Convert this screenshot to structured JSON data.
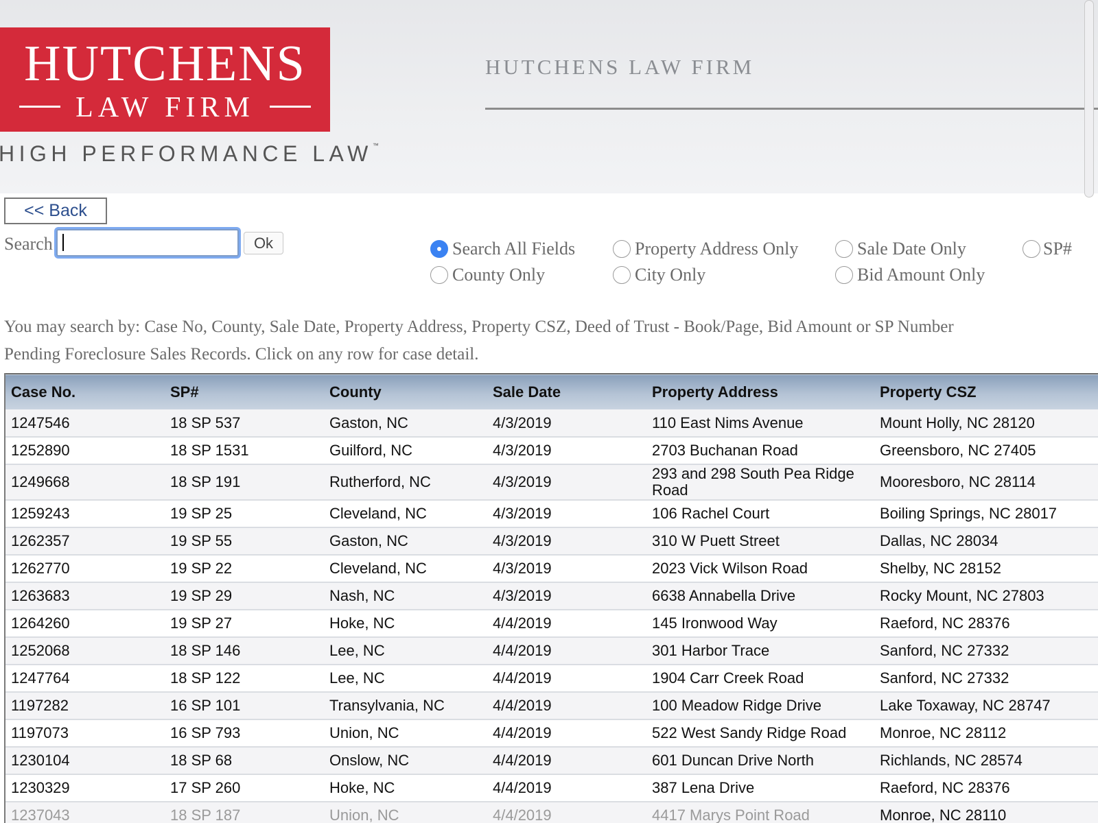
{
  "header": {
    "logo_name": "HUTCHENS",
    "logo_sub": "LAW FIRM",
    "tagline": "HIGH PERFORMANCE LAW",
    "tagline_tm": "™",
    "firm_title": "HUTCHENS LAW FIRM"
  },
  "controls": {
    "back_label": "<< Back",
    "search_label": "Search",
    "search_value": "",
    "ok_label": "Ok"
  },
  "radio_options": [
    {
      "label": "Search All Fields",
      "checked": true
    },
    {
      "label": "Property Address Only",
      "checked": false
    },
    {
      "label": "Sale Date Only",
      "checked": false
    },
    {
      "label": "SP#",
      "checked": false
    },
    {
      "label": "County Only",
      "checked": false
    },
    {
      "label": "City Only",
      "checked": false
    },
    {
      "label": "Bid Amount Only",
      "checked": false
    }
  ],
  "info": {
    "search_hint": "You may search by: Case No, County, Sale Date, Property Address, Property CSZ, Deed of Trust - Book/Page, Bid Amount or SP Number",
    "records_hint": "Pending Foreclosure Sales Records. Click on any row for case detail."
  },
  "table": {
    "columns": [
      "Case No.",
      "SP#",
      "County",
      "Sale Date",
      "Property Address",
      "Property CSZ"
    ],
    "rows": [
      [
        "1247546",
        "18 SP 537",
        "Gaston, NC",
        "4/3/2019",
        "110 East Nims Avenue",
        "Mount Holly, NC 28120"
      ],
      [
        "1252890",
        "18 SP 1531",
        "Guilford, NC",
        "4/3/2019",
        "2703 Buchanan Road",
        "Greensboro, NC 27405"
      ],
      [
        "1249668",
        "18 SP 191",
        "Rutherford, NC",
        "4/3/2019",
        "293 and 298 South Pea Ridge Road",
        "Mooresboro, NC 28114"
      ],
      [
        "1259243",
        "19 SP 25",
        "Cleveland, NC",
        "4/3/2019",
        "106 Rachel Court",
        "Boiling Springs, NC 28017"
      ],
      [
        "1262357",
        "19 SP 55",
        "Gaston, NC",
        "4/3/2019",
        "310 W Puett Street",
        "Dallas, NC 28034"
      ],
      [
        "1262770",
        "19 SP 22",
        "Cleveland, NC",
        "4/3/2019",
        "2023 Vick Wilson Road",
        "Shelby, NC 28152"
      ],
      [
        "1263683",
        "19 SP 29",
        "Nash, NC",
        "4/3/2019",
        "6638 Annabella Drive",
        "Rocky Mount, NC 27803"
      ],
      [
        "1264260",
        "19 SP 27",
        "Hoke, NC",
        "4/4/2019",
        "145 Ironwood Way",
        "Raeford, NC 28376"
      ],
      [
        "1252068",
        "18 SP 146",
        "Lee, NC",
        "4/4/2019",
        "301 Harbor Trace",
        "Sanford, NC 27332"
      ],
      [
        "1247764",
        "18 SP 122",
        "Lee, NC",
        "4/4/2019",
        "1904 Carr Creek Road",
        "Sanford, NC 27332"
      ],
      [
        "1197282",
        "16 SP 101",
        "Transylvania, NC",
        "4/4/2019",
        "100 Meadow Ridge Drive",
        "Lake Toxaway, NC 28747"
      ],
      [
        "1197073",
        "16 SP 793",
        "Union, NC",
        "4/4/2019",
        "522 West Sandy Ridge Road",
        "Monroe, NC 28112"
      ],
      [
        "1230104",
        "18 SP 68",
        "Onslow, NC",
        "4/4/2019",
        "601 Duncan Drive North",
        "Richlands, NC 28574"
      ],
      [
        "1230329",
        "17 SP 260",
        "Hoke, NC",
        "4/4/2019",
        "387 Lena Drive",
        "Raeford, NC 28376"
      ],
      [
        "1237043",
        "18 SP 187",
        "Union, NC",
        "4/4/2019",
        "4417 Marys Point Road",
        "Monroe, NC 28110"
      ]
    ]
  },
  "colors": {
    "logo_red": "#d42a3a",
    "radio_checked": "#3a82f2",
    "header_gradient_top": "#8aa0bb"
  }
}
